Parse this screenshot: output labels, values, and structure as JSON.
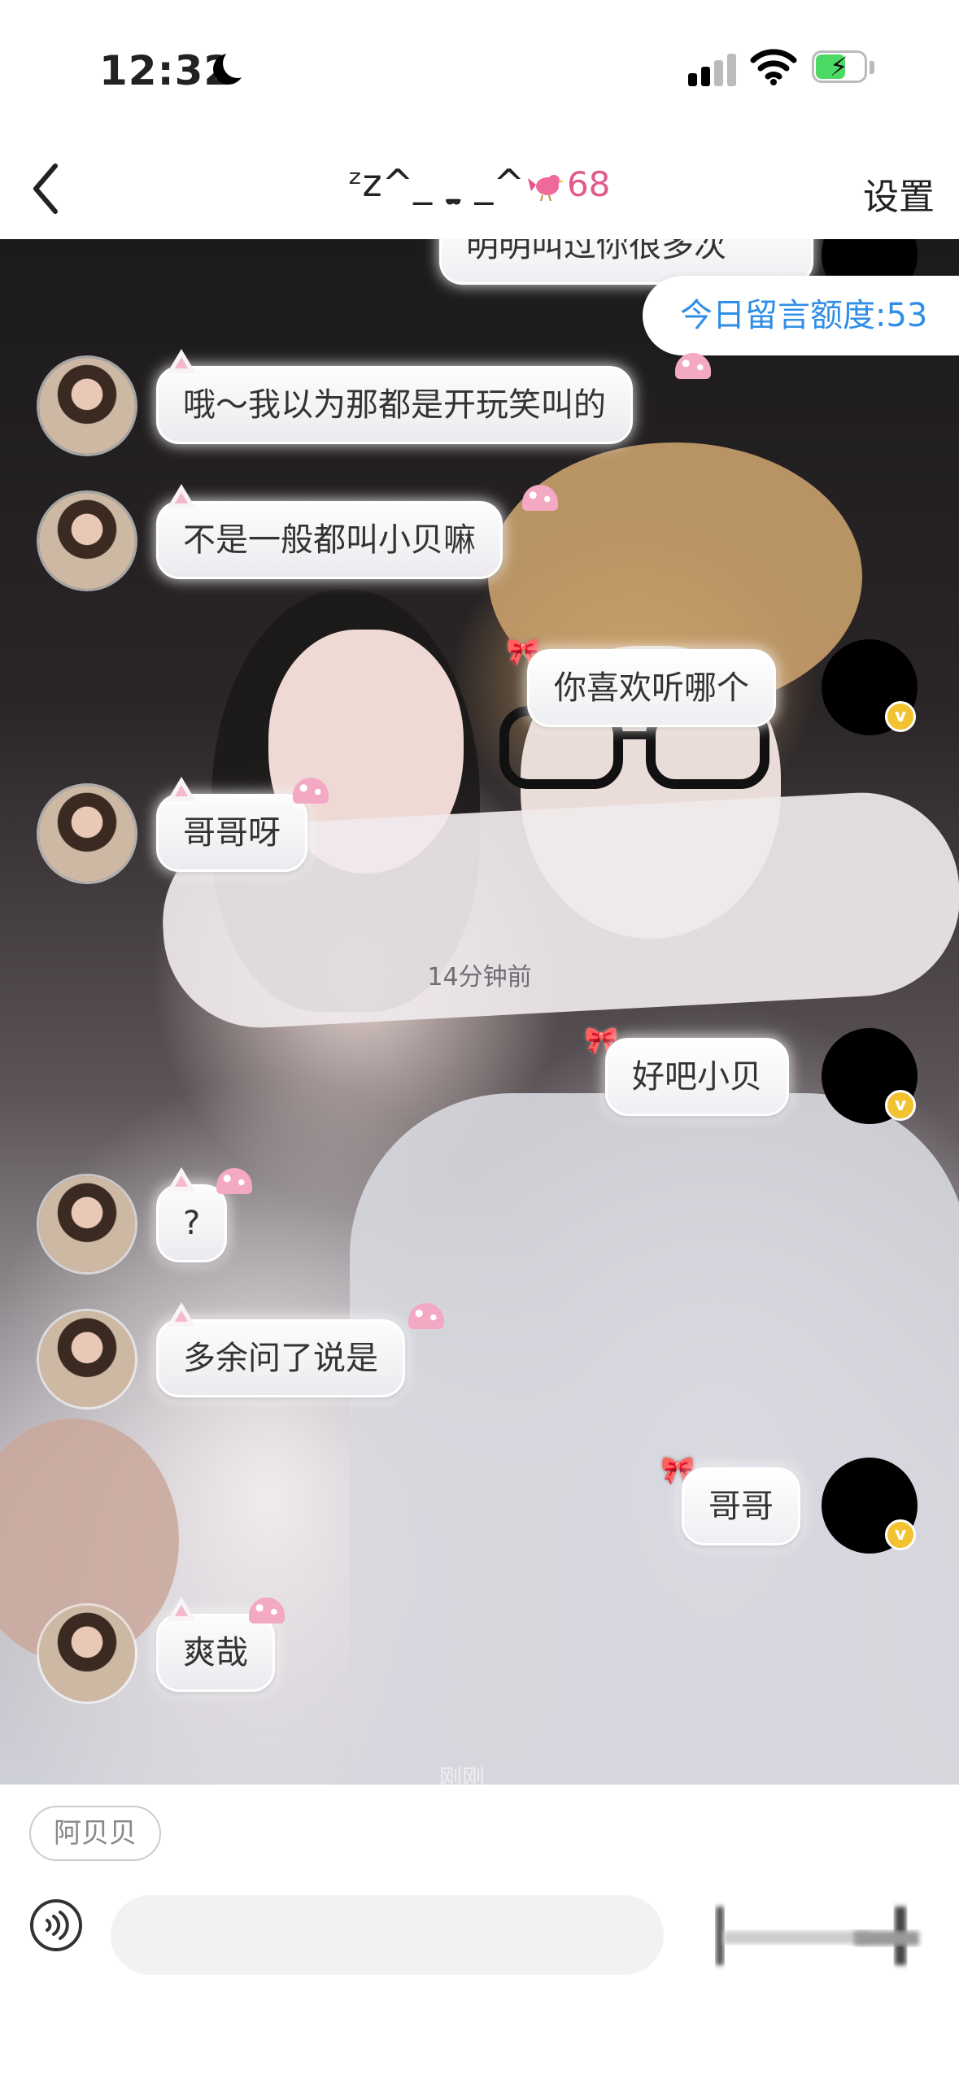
{
  "status_bar": {
    "time": "12:32"
  },
  "nav": {
    "title": "ᶻz^_ ˍ̫ _^",
    "level": "68",
    "settings_label": "设置"
  },
  "quota_label": "今日留言额度:53",
  "timestamp": "14分钟前",
  "bottom_fade": "刚刚",
  "messages": [
    {
      "side": "right",
      "text": "明明叫过你很多次"
    },
    {
      "side": "left",
      "text": "哦～我以为那都是开玩笑叫的"
    },
    {
      "side": "left",
      "text": "不是一般都叫小贝嘛"
    },
    {
      "side": "right",
      "text": "你喜欢听哪个"
    },
    {
      "side": "left",
      "text": "哥哥呀"
    },
    {
      "side": "right",
      "text": "好吧小贝"
    },
    {
      "side": "left",
      "text": "?"
    },
    {
      "side": "left",
      "text": "多余问了说是"
    },
    {
      "side": "right",
      "text": "哥哥"
    },
    {
      "side": "left",
      "text": "爽哉"
    }
  ],
  "badge_letter": "v",
  "tag_chip": "阿贝贝",
  "input_placeholder": "",
  "colors": {
    "accent_blue": "#2f8ee6",
    "level_pink": "#e05a8c",
    "vip_gold": "#f2c230"
  }
}
